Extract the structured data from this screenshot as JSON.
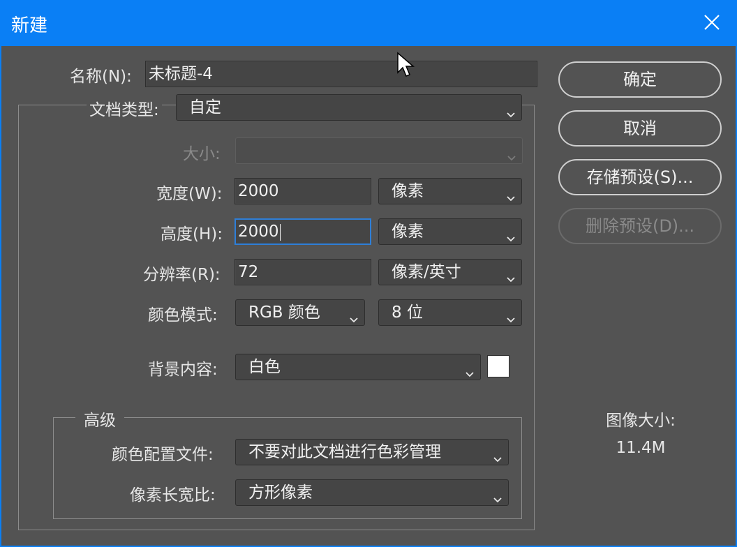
{
  "window": {
    "title": "新建"
  },
  "form": {
    "name_label": "名称(N):",
    "name_value": "未标题-4",
    "doc_type_label": "文档类型:",
    "doc_type_value": "自定",
    "size_label": "大小:",
    "size_value": "",
    "width_label": "宽度(W):",
    "width_value": "2000",
    "width_unit": "像素",
    "height_label": "高度(H):",
    "height_value": "2000",
    "height_unit": "像素",
    "resolution_label": "分辨率(R):",
    "resolution_value": "72",
    "resolution_unit": "像素/英寸",
    "color_mode_label": "颜色模式:",
    "color_mode_value": "RGB 颜色",
    "bit_depth_value": "8 位",
    "background_label": "背景内容:",
    "background_value": "白色",
    "background_swatch_color": "#ffffff"
  },
  "advanced": {
    "title": "高级",
    "color_profile_label": "颜色配置文件:",
    "color_profile_value": "不要对此文档进行色彩管理",
    "pixel_aspect_label": "像素长宽比:",
    "pixel_aspect_value": "方形像素"
  },
  "buttons": {
    "ok": "确定",
    "cancel": "取消",
    "save_preset": "存储预设(S)...",
    "delete_preset": "删除预设(D)..."
  },
  "image_size": {
    "label": "图像大小:",
    "value": "11.4M"
  },
  "colors": {
    "titlebar": "#0a7ff5",
    "dialog_bg": "#535353",
    "field_bg": "#454545",
    "focus_border": "#2e7fd8"
  }
}
